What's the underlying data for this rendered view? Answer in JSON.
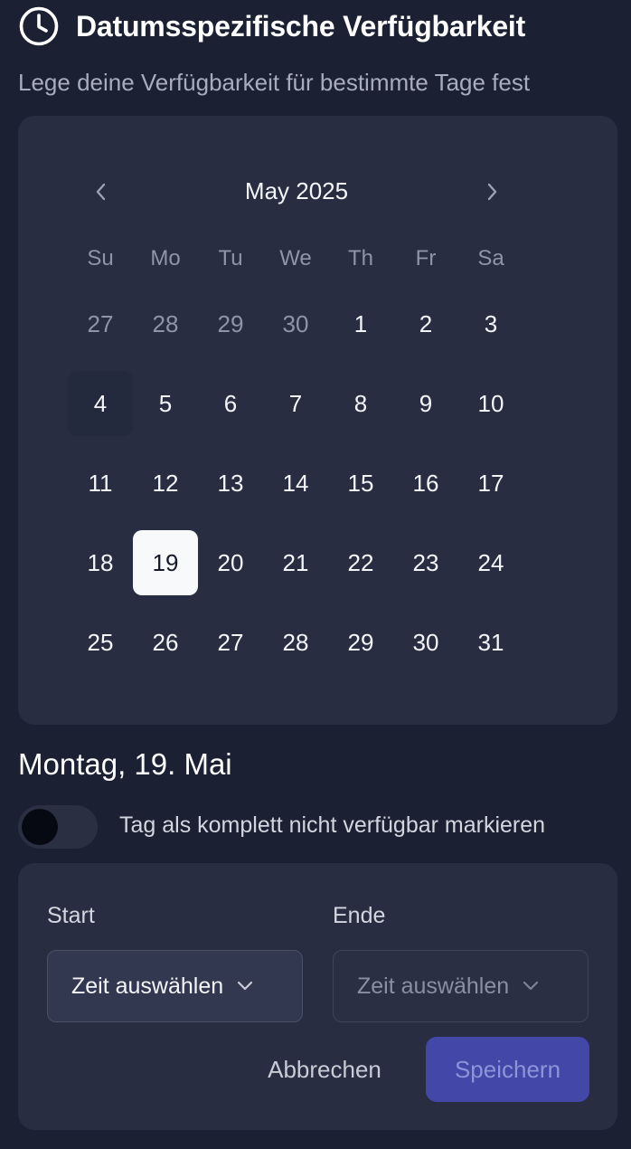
{
  "header": {
    "title": "Datumsspezifische Verfügbarkeit",
    "subtitle": "Lege deine Verfügbarkeit für bestimmte Tage fest",
    "icon": "clock-icon"
  },
  "calendar": {
    "month_label": "May 2025",
    "weekdays": [
      "Su",
      "Mo",
      "Tu",
      "We",
      "Th",
      "Fr",
      "Sa"
    ],
    "weeks": [
      [
        "27",
        "28",
        "29",
        "30",
        "1",
        "2",
        "3"
      ],
      [
        "4",
        "5",
        "6",
        "7",
        "8",
        "9",
        "10"
      ],
      [
        "11",
        "12",
        "13",
        "14",
        "15",
        "16",
        "17"
      ],
      [
        "18",
        "19",
        "20",
        "21",
        "22",
        "23",
        "24"
      ],
      [
        "25",
        "26",
        "27",
        "28",
        "29",
        "30",
        "31"
      ]
    ],
    "outside_days": [
      [
        0,
        0
      ],
      [
        0,
        1
      ],
      [
        0,
        2
      ],
      [
        0,
        3
      ]
    ],
    "today": [
      1,
      0
    ],
    "selected": [
      3,
      1
    ],
    "prev_icon": "chevron-left-icon",
    "next_icon": "chevron-right-icon"
  },
  "day_settings": {
    "selected_date": "Montag, 19. Mai",
    "toggle_label": "Tag als komplett nicht verfügbar markieren",
    "toggle_on": false
  },
  "time_form": {
    "start_label": "Start",
    "end_label": "Ende",
    "start_value": "Zeit auswählen",
    "end_value": "Zeit auswählen",
    "cancel_label": "Abbrechen",
    "save_label": "Speichern"
  },
  "colors": {
    "background": "#1b2033",
    "card": "#282d41",
    "selected_day": "#f8f9fb",
    "save_button": "#4347a8"
  }
}
